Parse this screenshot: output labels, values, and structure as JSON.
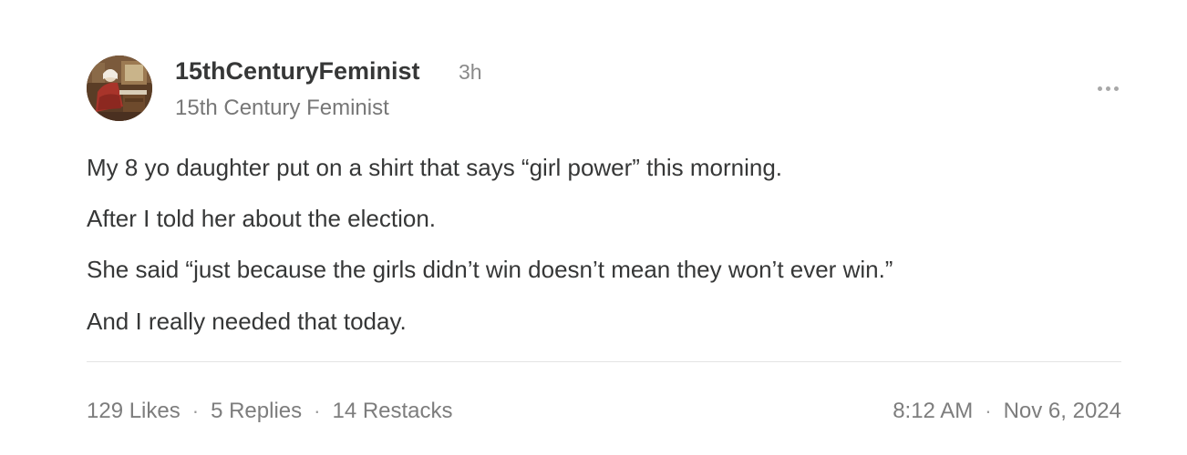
{
  "post": {
    "author": {
      "handle": "15thCenturyFeminist",
      "display_name": "15th Century Feminist",
      "avatar_icon": "medieval-painting-avatar"
    },
    "age": "3h",
    "more_icon": "ellipsis-icon",
    "paragraphs": [
      "My 8 yo daughter put on a shirt that says “girl power” this morning.",
      "After I told her about the election.",
      "She said “just because the girls didn’t win doesn’t mean they won’t ever win.”",
      "And I really needed that today."
    ],
    "stats": {
      "likes": "129 Likes",
      "replies": "5 Replies",
      "restacks": "14 Restacks",
      "separator": "·"
    },
    "timestamp": {
      "time": "8:12 AM",
      "date": "Nov 6, 2024"
    }
  }
}
